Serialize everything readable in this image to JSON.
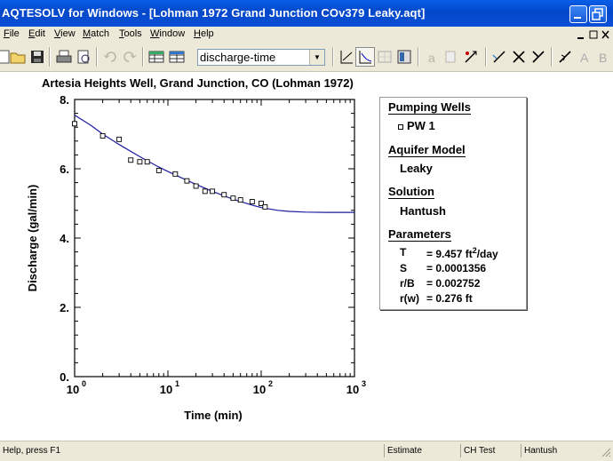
{
  "window": {
    "title": "AQTESOLV for Windows - [Lohman 1972 Grand Junction COv379 Leaky.aqt]"
  },
  "menu": [
    "File",
    "Edit",
    "View",
    "Match",
    "Tools",
    "Window",
    "Help"
  ],
  "toolbar": {
    "view_select": "discharge-time"
  },
  "plot": {
    "title": "Artesia Heights Well, Grand Junction, CO (Lohman 1972)"
  },
  "legend": {
    "pumping_wells_heading": "Pumping Wells",
    "pumping_well": "PW 1",
    "aquifer_model_heading": "Aquifer Model",
    "aquifer_model": "Leaky",
    "solution_heading": "Solution",
    "solution": "Hantush",
    "parameters_heading": "Parameters",
    "params": [
      {
        "name": "T",
        "value": "= 9.457 ft",
        "unit_sup": "2",
        "unit_tail": "/day"
      },
      {
        "name": "S",
        "value": "= 0.0001356"
      },
      {
        "name": "r/B",
        "value": "= 0.002752"
      },
      {
        "name": "r(w)",
        "value": "= 0.276 ft"
      }
    ]
  },
  "status": {
    "help": "Help, press F1",
    "mode": "Estimate",
    "test": "CH Test",
    "solution": "Hantush"
  },
  "chart_data": {
    "type": "scatter",
    "title": "",
    "xlabel": "Time (min)",
    "ylabel": "Discharge (gal/min)",
    "x_scale": "log",
    "xlim": [
      1,
      1000
    ],
    "ylim": [
      0,
      8
    ],
    "x_ticks": [
      {
        "base": "10",
        "exp": "0",
        "value": 1
      },
      {
        "base": "10",
        "exp": "1",
        "value": 10
      },
      {
        "base": "10",
        "exp": "2",
        "value": 100
      },
      {
        "base": "10",
        "exp": "3",
        "value": 1000
      }
    ],
    "y_ticks": [
      "0.",
      "2.",
      "4.",
      "6.",
      "8."
    ],
    "y_tick_values": [
      0,
      2,
      4,
      6,
      8
    ],
    "series": [
      {
        "name": "PW 1",
        "kind": "points",
        "x": [
          1.0,
          2.0,
          3.0,
          4.0,
          5.0,
          6.0,
          8.0,
          12.0,
          16.0,
          20.0,
          25.0,
          30.0,
          40.0,
          50.0,
          60.0,
          80.0,
          100.0,
          110.0
        ],
        "y": [
          7.3,
          6.95,
          6.85,
          6.25,
          6.2,
          6.2,
          5.95,
          5.85,
          5.65,
          5.5,
          5.35,
          5.35,
          5.25,
          5.15,
          5.1,
          5.05,
          5.0,
          4.9
        ]
      },
      {
        "name": "Hantush",
        "kind": "line",
        "x": [
          1,
          1.5,
          2,
          3,
          5,
          8,
          10,
          15,
          20,
          30,
          50,
          80,
          100,
          150,
          200,
          300,
          500,
          1000
        ],
        "y": [
          7.55,
          7.25,
          7.0,
          6.7,
          6.35,
          6.05,
          5.92,
          5.7,
          5.55,
          5.35,
          5.12,
          4.95,
          4.88,
          4.8,
          4.77,
          4.75,
          4.74,
          4.74
        ]
      }
    ],
    "grid": false,
    "legend": "right"
  }
}
